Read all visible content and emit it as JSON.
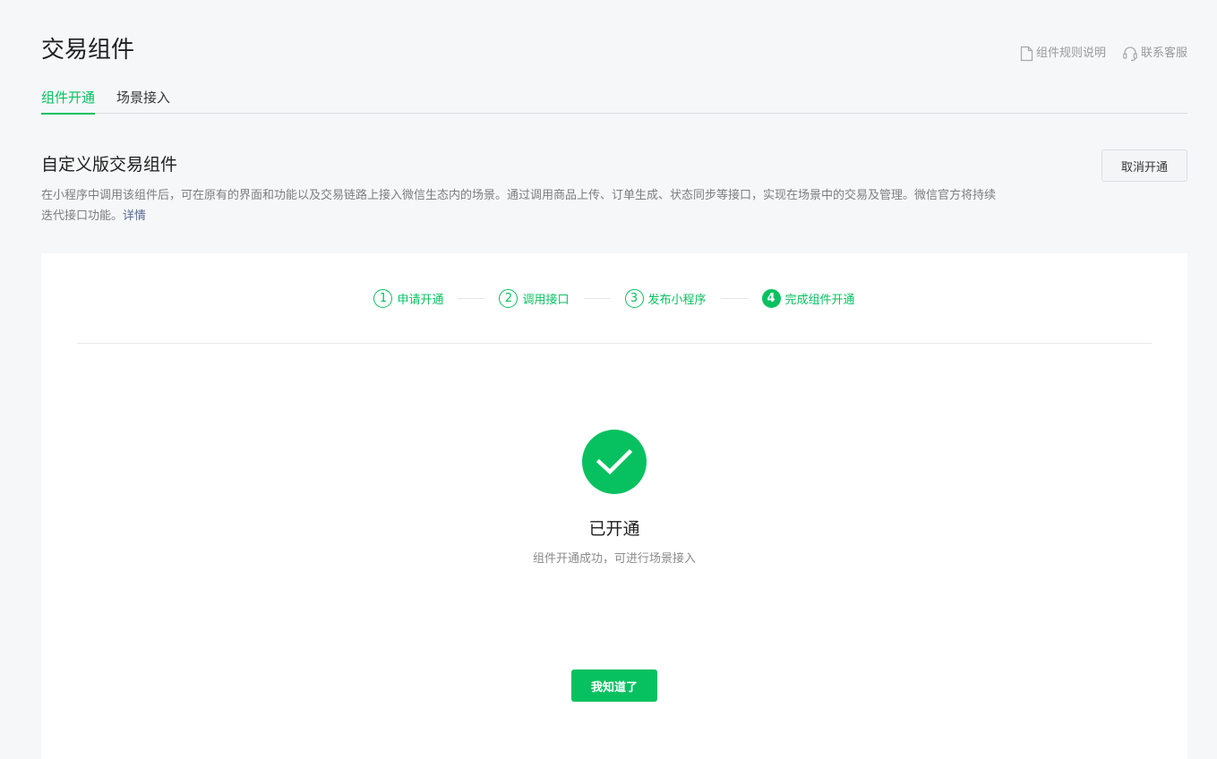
{
  "header": {
    "title": "交易组件",
    "links": [
      {
        "label": "组件规则说明",
        "icon": "document-icon"
      },
      {
        "label": "联系客服",
        "icon": "headset-icon"
      }
    ]
  },
  "tabs": [
    {
      "label": "组件开通",
      "active": true
    },
    {
      "label": "场景接入",
      "active": false
    }
  ],
  "section": {
    "title": "自定义版交易组件",
    "description": "在小程序中调用该组件后，可在原有的界面和功能以及交易链路上接入微信生态内的场景。通过调用商品上传、订单生成、状态同步等接口，实现在场景中的交易及管理。微信官方将持续迭代接口功能。",
    "detail_link": "详情",
    "cancel_button": "取消开通"
  },
  "steps": [
    {
      "number": "1",
      "label": "申请开通",
      "status": "done"
    },
    {
      "number": "2",
      "label": "调用接口",
      "status": "done"
    },
    {
      "number": "3",
      "label": "发布小程序",
      "status": "done"
    },
    {
      "number": "4",
      "label": "完成组件开通",
      "status": "current"
    }
  ],
  "result": {
    "icon": "check-icon",
    "title": "已开通",
    "description": "组件开通成功，可进行场景接入",
    "button": "我知道了"
  },
  "colors": {
    "accent": "#07c160",
    "link": "#576b95",
    "background": "#f6f7f9"
  }
}
